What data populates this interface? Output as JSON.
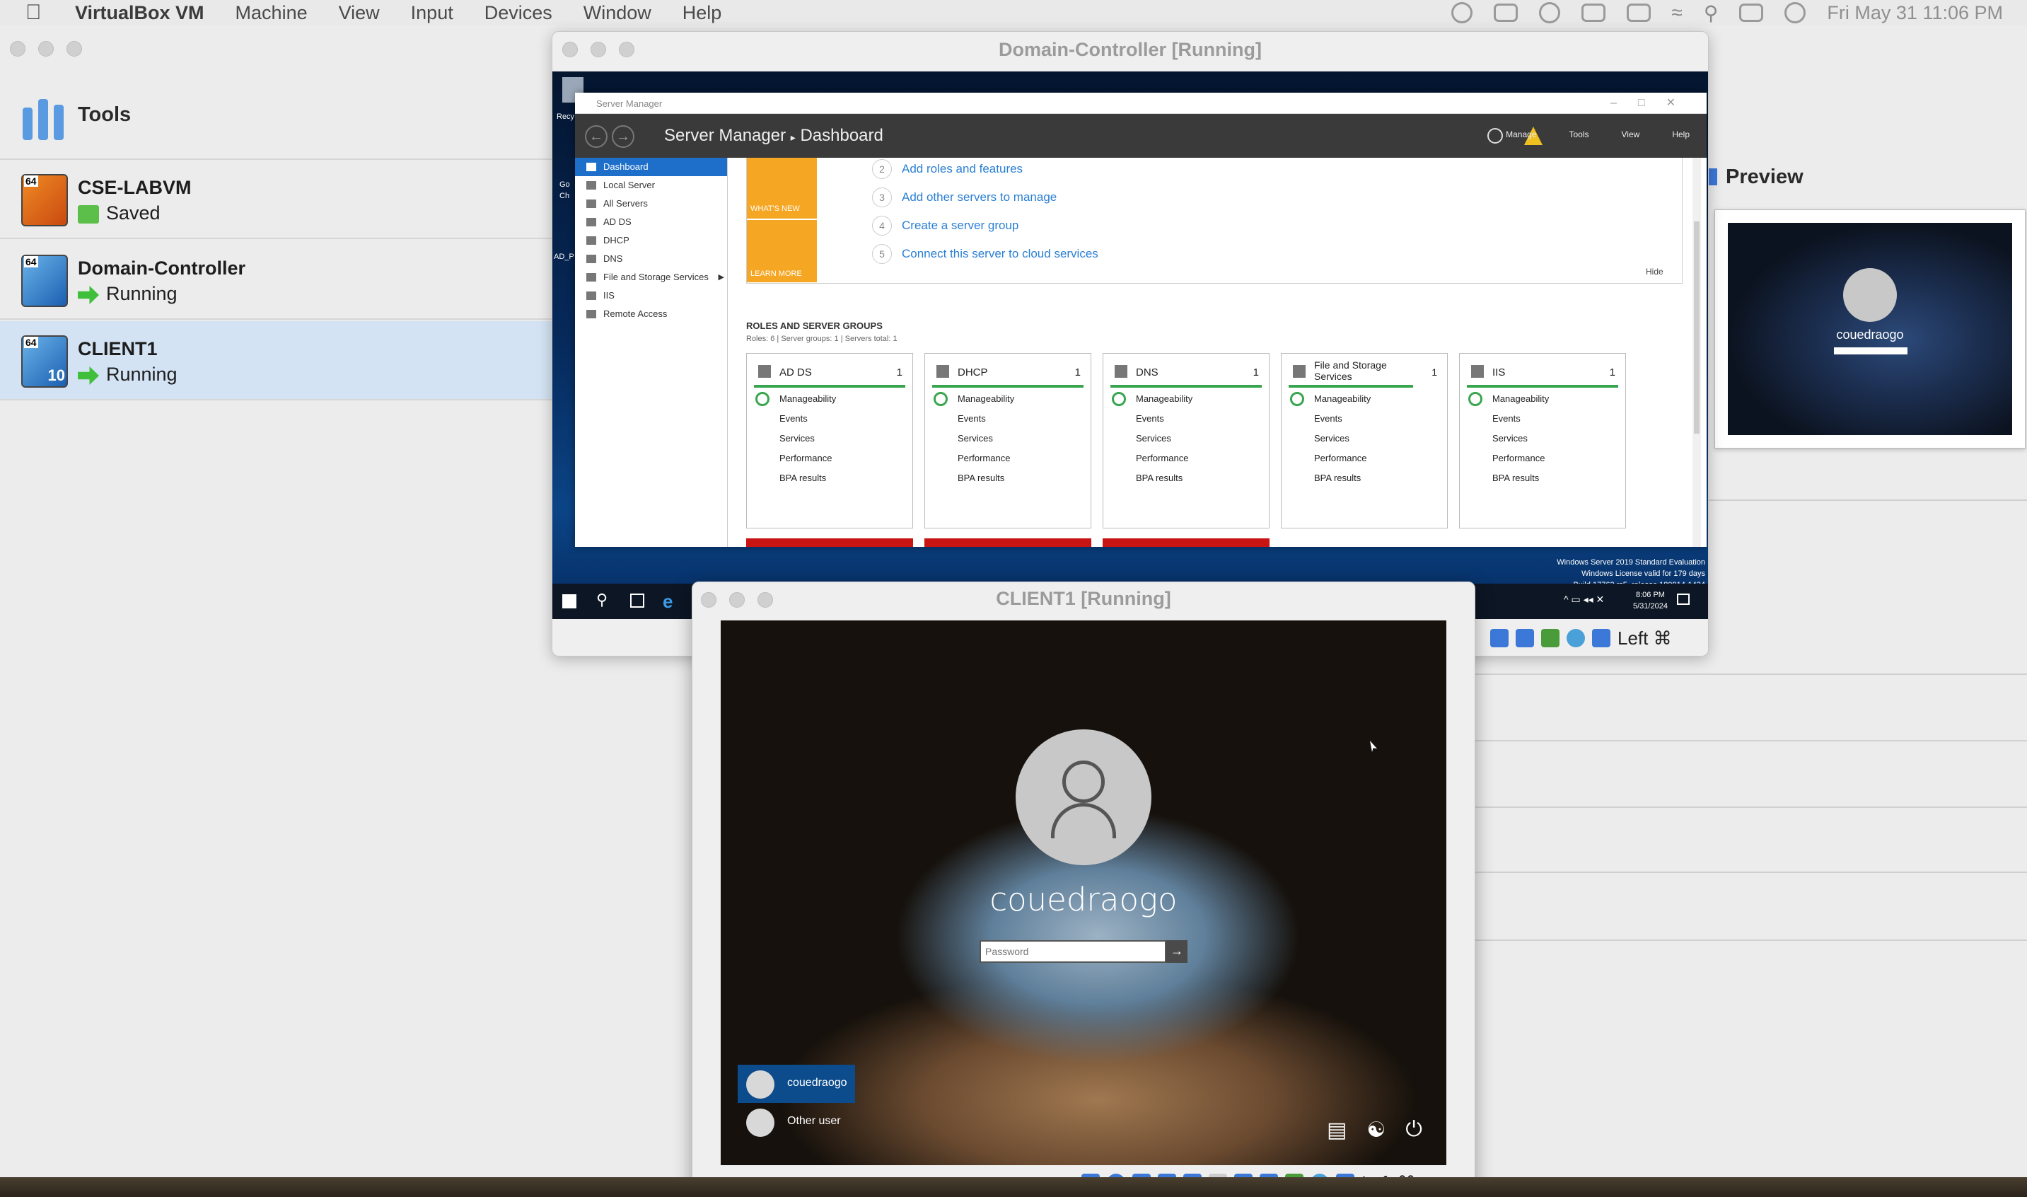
{
  "menubar": {
    "app": "VirtualBox VM",
    "items": [
      "Machine",
      "View",
      "Input",
      "Devices",
      "Window",
      "Help"
    ],
    "datetime": "Fri May 31  11:06 PM"
  },
  "sidebar": {
    "tools_label": "Tools",
    "vms": [
      {
        "name": "CSE-LABVM",
        "state": "Saved"
      },
      {
        "name": "Domain-Controller",
        "state": "Running"
      },
      {
        "name": "CLIENT1",
        "state": "Running"
      }
    ],
    "badges": {
      "bits": "64",
      "win10": "10"
    }
  },
  "preview": {
    "title": "Preview",
    "thumb_user": "couedraogo"
  },
  "dc_window": {
    "title": "Domain-Controller [Running]",
    "host_key": "Left ⌘",
    "server_manager": {
      "window_title": "Server Manager",
      "breadcrumb_app": "Server Manager",
      "breadcrumb_sep": "▸",
      "breadcrumb_page": "Dashboard",
      "menu": [
        "Manage",
        "Tools",
        "View",
        "Help"
      ],
      "nav": [
        "Dashboard",
        "Local Server",
        "All Servers",
        "AD DS",
        "DHCP",
        "DNS",
        "File and Storage Services",
        "IIS",
        "Remote Access"
      ],
      "whats_new": "WHAT'S NEW",
      "learn_more": "LEARN MORE",
      "quick_start": [
        {
          "num": "2",
          "text": "Add roles and features"
        },
        {
          "num": "3",
          "text": "Add other servers to manage"
        },
        {
          "num": "4",
          "text": "Create a server group"
        },
        {
          "num": "5",
          "text": "Connect this server to cloud services"
        }
      ],
      "hide": "Hide",
      "roles_header": "ROLES AND SERVER GROUPS",
      "roles_sub": "Roles: 6   |   Server groups: 1   |   Servers total: 1",
      "tiles": [
        {
          "name": "AD DS",
          "count": "1"
        },
        {
          "name": "DHCP",
          "count": "1"
        },
        {
          "name": "DNS",
          "count": "1"
        },
        {
          "name": "File and Storage Services",
          "count": "1"
        },
        {
          "name": "IIS",
          "count": "1"
        }
      ],
      "tile_rows": [
        "Manageability",
        "Events",
        "Services",
        "Performance",
        "BPA results"
      ]
    },
    "watermark": [
      "Windows Server 2019 Standard Evaluation",
      "Windows License valid for 179 days",
      "Build 17763.rs5_release.180914-1434"
    ],
    "clock_time": "8:06 PM",
    "clock_date": "5/31/2024",
    "desktop_labels": [
      "Recy",
      "Go",
      "Ch",
      "AD_P"
    ]
  },
  "client_window": {
    "title": "CLIENT1 [Running]",
    "username": "couedraogo",
    "password_placeholder": "Password",
    "users": [
      "couedraogo",
      "Other user"
    ],
    "host_key": "Left ⌘"
  },
  "colors": {
    "accent": "#1d6fc9",
    "selection": "#d3e3f3",
    "green": "#3aa54f",
    "orange": "#f5a623",
    "red": "#c91414"
  }
}
